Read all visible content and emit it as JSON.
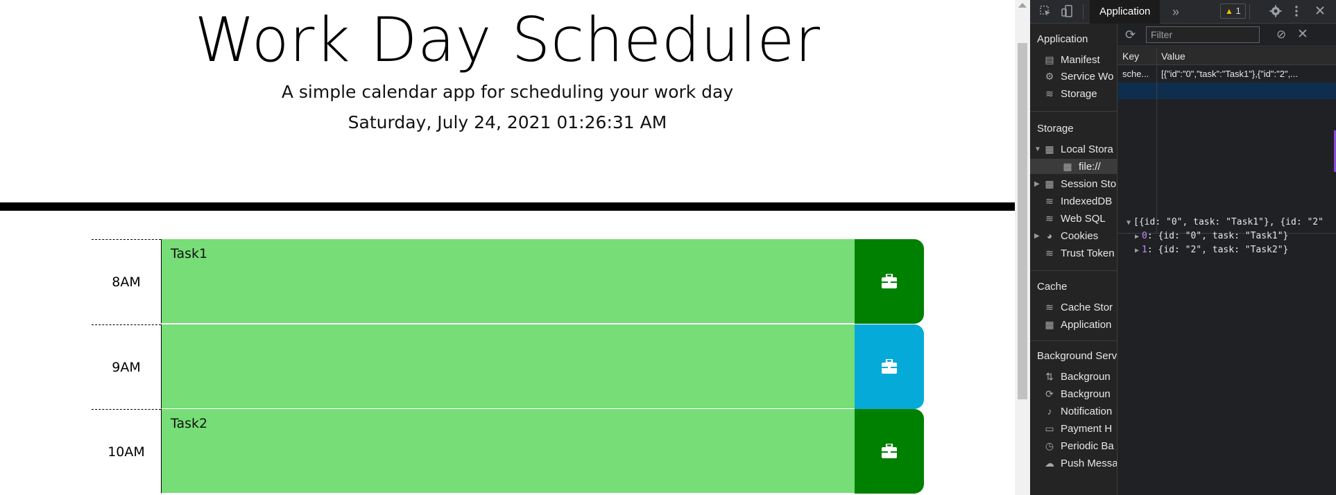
{
  "page": {
    "title": "Work Day Scheduler",
    "lead": "A simple calendar app for scheduling your work day",
    "current_date": "Saturday, July 24, 2021 01:26:31 AM",
    "rows": [
      {
        "hour": "8AM",
        "task": "Task1",
        "state": "green"
      },
      {
        "hour": "9AM",
        "task": "",
        "state": "blue"
      },
      {
        "hour": "10AM",
        "task": "Task2",
        "state": "green"
      }
    ]
  },
  "devtools": {
    "active_tab": "Application",
    "overflow": "»",
    "warning_count": "1",
    "sidebar": {
      "application_header": "Application",
      "application_items": [
        "Manifest",
        "Service Wo",
        "Storage"
      ],
      "storage_header": "Storage",
      "storage_items": [
        "Local Stora",
        "file://",
        "Session Sto",
        "IndexedDB",
        "Web SQL",
        "Cookies",
        "Trust Token"
      ],
      "cache_header": "Cache",
      "cache_items": [
        "Cache Stor",
        "Application"
      ],
      "background_header": "Background Servi",
      "background_items": [
        "Backgroun",
        "Backgroun",
        "Notification",
        "Payment H",
        "Periodic Ba",
        "Push Messa"
      ]
    },
    "filter_placeholder": "Filter",
    "table": {
      "headers": [
        "Key",
        "Value"
      ],
      "rows": [
        {
          "key": "sche...",
          "value": "[{\"id\":\"0\",\"task\":\"Task1\"},{\"id\":\"2\",..."
        }
      ]
    },
    "preview": {
      "root": "[{id: \"0\", task: \"Task1\"}, {id: \"2\"",
      "items": [
        {
          "index": "0",
          "text": "{id: \"0\", task: \"Task1\"}"
        },
        {
          "index": "1",
          "text": "{id: \"2\", task: \"Task2\"}"
        }
      ]
    },
    "colors": {
      "accent_green": "#008000",
      "accent_blue": "#06aad8",
      "task_bg": "#77dd77"
    }
  }
}
